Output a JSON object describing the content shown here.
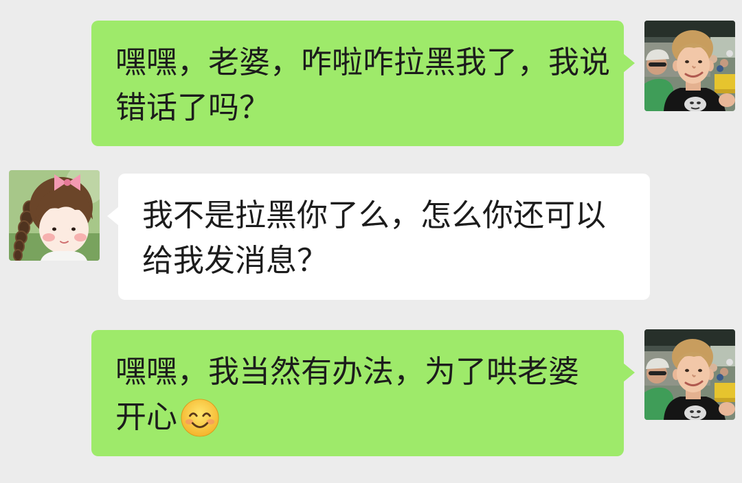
{
  "theme": {
    "background_color": "#ececec",
    "sent_bubble_color": "#9eea6a",
    "received_bubble_color": "#ffffff",
    "text_color": "#1c1c1c"
  },
  "messages": [
    {
      "outgoing": true,
      "avatar_icon": "boy-photo-avatar-icon",
      "lines": [
        "嘿嘿，老婆，咋啦咋拉黑我了，我说",
        "错话了吗？"
      ]
    },
    {
      "outgoing": false,
      "avatar_icon": "cartoon-girl-avatar-icon",
      "lines": [
        "我不是拉黑你了么，怎么你还可以",
        "给我发消息？"
      ]
    },
    {
      "outgoing": true,
      "avatar_icon": "boy-photo-avatar-icon",
      "lines": [
        "嘿嘿，我当然有办法，为了哄老婆",
        "开心"
      ],
      "trailing_emoji_icon": "smiling-face-emoji-icon"
    }
  ]
}
